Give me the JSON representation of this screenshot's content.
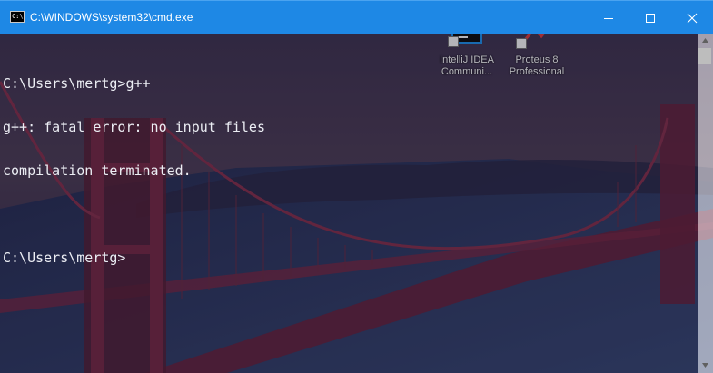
{
  "window": {
    "title": "C:\\WINDOWS\\system32\\cmd.exe",
    "app_icon_text": "C:\\",
    "accent_color": "#1e88e5"
  },
  "console": {
    "lines": [
      "",
      "C:\\Users\\mertg>g++",
      "g++: fatal error: no input files",
      "compilation terminated.",
      "",
      "C:\\Users\\mertg>"
    ],
    "text_color": "#eceef4"
  },
  "desktop": {
    "icons": [
      {
        "label": "IntelliJ IDEA\nCommuni...",
        "icon": "intellij-idea-icon",
        "tile_text": "IJ"
      },
      {
        "label": "Proteus 8\nProfessional",
        "icon": "proteus-icon"
      }
    ],
    "wallpaper": "golden-gate-bridge"
  }
}
